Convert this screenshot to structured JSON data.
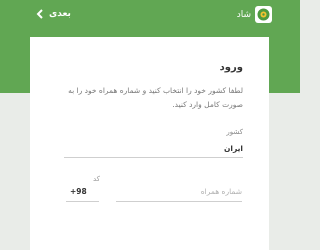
{
  "header": {
    "back_label": "بعدی",
    "brand_name": "شاد",
    "back_icon": "chevron-left-icon",
    "logo_icon": "shad-logo-icon",
    "colors": {
      "bar": "#61a753",
      "logo_green": "#4e9a3f",
      "logo_yellow": "#f2c230"
    }
  },
  "login": {
    "title": "ورود",
    "instruction": "لطفا کشور خود را انتخاب کنید و شماره همراه خود را به صورت کامل وارد کنید.",
    "country_label": "کشور",
    "country_value": "ایران",
    "code_label": "کد",
    "code_value": "+98",
    "phone_placeholder": "شماره همراه",
    "phone_value": ""
  }
}
